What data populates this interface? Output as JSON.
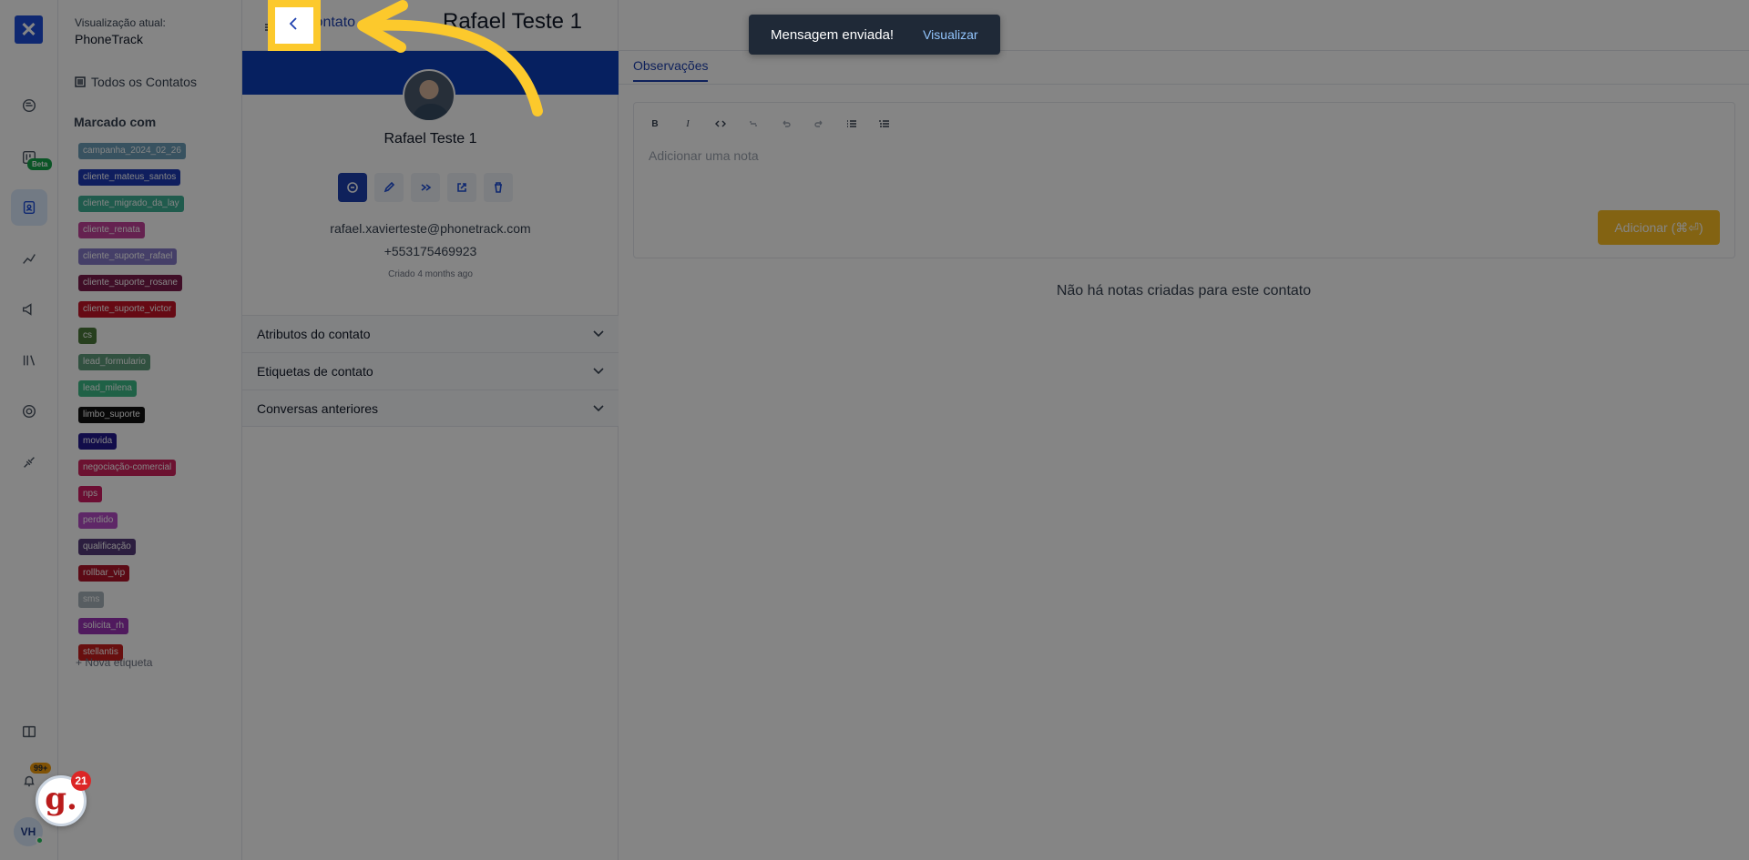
{
  "rail": {
    "logo": "✕",
    "beta_badge": "Beta",
    "notifications_badge": "99+",
    "avatar_initials": "VH"
  },
  "sidebar": {
    "view_label": "Visualização atual:",
    "view_name": "PhoneTrack",
    "all_contacts": "Todos os Contatos",
    "tagged_with": "Marcado com",
    "tags": [
      {
        "label": "campanha_2024_02_26",
        "color": "#6b9db8"
      },
      {
        "label": "cliente_mateus_santos",
        "color": "#1d3ab5"
      },
      {
        "label": "cliente_migrado_da_lay",
        "color": "#3fae94"
      },
      {
        "label": "cliente_renata",
        "color": "#c2429a"
      },
      {
        "label": "cliente_suporte_rafael",
        "color": "#8579c8"
      },
      {
        "label": "cliente_suporte_rosane",
        "color": "#7c1b4c"
      },
      {
        "label": "cliente_suporte_victor",
        "color": "#c41428"
      },
      {
        "label": "cs",
        "color": "#4b7a3a"
      },
      {
        "label": "lead_formulario",
        "color": "#5e9b7c"
      },
      {
        "label": "lead_milena",
        "color": "#3dba86"
      },
      {
        "label": "limbo_suporte",
        "color": "#111111"
      },
      {
        "label": "movida",
        "color": "#231a8e"
      },
      {
        "label": "negociação-comercial",
        "color": "#d0245e"
      },
      {
        "label": "nps",
        "color": "#d01c62"
      },
      {
        "label": "perdido",
        "color": "#b54bc6"
      },
      {
        "label": "qualificação",
        "color": "#553a7a"
      },
      {
        "label": "rollbar_vip",
        "color": "#b0142a"
      },
      {
        "label": "sms",
        "color": "#a7b3ba"
      },
      {
        "label": "solicita_rh",
        "color": "#9a32b4"
      },
      {
        "label": "stellantis",
        "color": "#c81e1e"
      }
    ],
    "new_tag": "+ Nova etiqueta"
  },
  "header": {
    "back_label": "Contato",
    "title": "Rafael Teste 1"
  },
  "contact": {
    "name": "Rafael Teste 1",
    "email": "rafael.xavierteste@phonetrack.com",
    "phone": "+553175469923",
    "created": "Criado 4 months ago",
    "sections": [
      "Atributos do contato",
      "Etiquetas de contato",
      "Conversas anteriores"
    ]
  },
  "notes": {
    "tab": "Observações",
    "placeholder": "Adicionar uma nota",
    "add_button": "Adicionar (⌘⏎)",
    "empty": "Não há notas criadas para este contato"
  },
  "toast": {
    "message": "Mensagem enviada!",
    "action": "Visualizar"
  },
  "gbadge": {
    "letter": "g.",
    "count": "21"
  },
  "colors": {
    "highlight": "#fcc92c",
    "primary": "#1e40af",
    "cover": "#0d3fb8"
  }
}
